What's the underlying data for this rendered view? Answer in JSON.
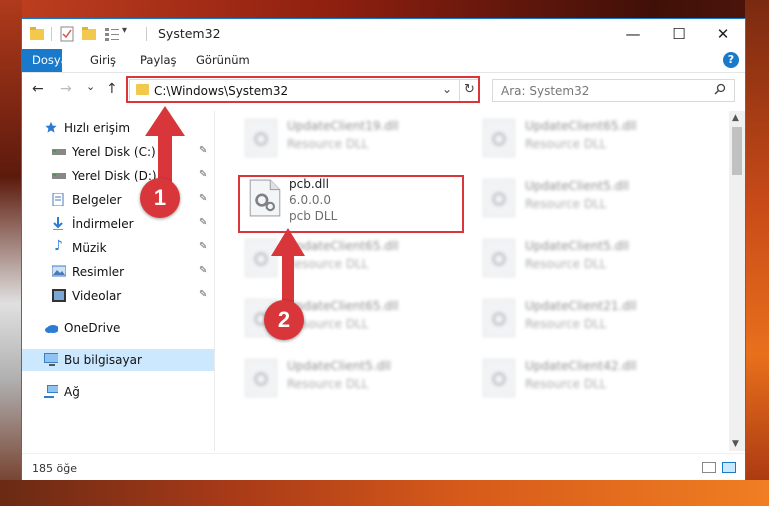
{
  "window": {
    "title": "System32",
    "minimize": "—",
    "maximize": "☐",
    "close": "✕"
  },
  "ribbon": {
    "tabs": [
      {
        "label": "Dosya",
        "active": true
      },
      {
        "label": "Giriş"
      },
      {
        "label": "Paylaş"
      },
      {
        "label": "Görünüm"
      }
    ],
    "help": "?"
  },
  "nav": {
    "back": "←",
    "forward": "→",
    "recent": "⌄",
    "up": "↑",
    "address": "C:\\Windows\\System32",
    "address_dropdown": "⌄",
    "refresh": "↻",
    "search_placeholder": "Ara: System32"
  },
  "sidebar": {
    "items": [
      {
        "label": "Hızlı erişim",
        "icon": "star-icon"
      },
      {
        "label": "Yerel Disk (C:)",
        "icon": "drive-icon",
        "pinned": true
      },
      {
        "label": "Yerel Disk (D:)",
        "icon": "drive-icon",
        "pinned": true
      },
      {
        "label": "Belgeler",
        "icon": "document-icon",
        "pinned": true
      },
      {
        "label": "İndirmeler",
        "icon": "download-icon",
        "pinned": true
      },
      {
        "label": "Müzik",
        "icon": "music-icon",
        "pinned": true
      },
      {
        "label": "Resimler",
        "icon": "picture-icon",
        "pinned": true
      },
      {
        "label": "Videolar",
        "icon": "video-icon",
        "pinned": true
      },
      {
        "label": "OneDrive",
        "icon": "cloud-icon"
      },
      {
        "label": "Bu bilgisayar",
        "icon": "computer-icon",
        "selected": true
      },
      {
        "label": "Ağ",
        "icon": "network-icon"
      }
    ],
    "pin_glyph": "📌"
  },
  "files": {
    "left_column": [
      {
        "name": "UpdateClient19.dll",
        "type": "Resource DLL"
      },
      {
        "name": "UpdateClient65.dll",
        "type": "Resource DLL"
      },
      {
        "name": "UpdateClient65.dll",
        "type": "Resource DLL"
      },
      {
        "name": "UpdateClient5.dll",
        "type": "Resource DLL"
      }
    ],
    "right_column": [
      {
        "name": "UpdateClient65.dll",
        "type": "Resource DLL"
      },
      {
        "name": "UpdateClient5.dll",
        "type": "Resource DLL"
      },
      {
        "name": "UpdateClient5.dll",
        "type": "Resource DLL"
      },
      {
        "name": "UpdateClient21.dll",
        "type": "Resource DLL"
      },
      {
        "name": "UpdateClient42.dll",
        "type": "Resource DLL"
      }
    ],
    "highlighted": {
      "name": "pcb.dll",
      "version": "6.0.0.0",
      "type": "pcb DLL"
    }
  },
  "status": {
    "count": "185 öğe"
  },
  "annotations": {
    "step1": "1",
    "step2": "2",
    "color": "#d8363a"
  },
  "colors": {
    "accent": "#1979ca",
    "selection": "#cce8ff"
  }
}
